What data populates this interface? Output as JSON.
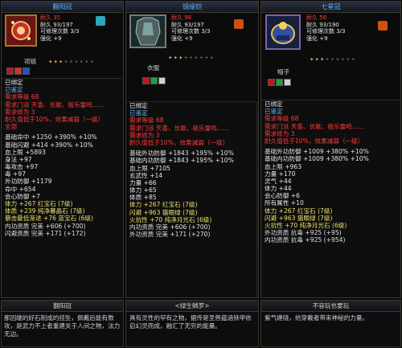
{
  "cards": [
    {
      "title": "翻阳冠",
      "info": [
        "耐久 35",
        "耐久 93/197",
        "可修理次数 3/3",
        "强化 +9"
      ],
      "type_label": "项链",
      "stars_on": 3,
      "stars_total": 9,
      "icon_name": "crown-icon",
      "lines": [
        {
          "c": "w",
          "t": "已绑定"
        },
        {
          "c": "b",
          "t": "已鉴定"
        },
        {
          "c": "r",
          "t": "需求等级 68"
        },
        {
          "c": "r",
          "t": "需求门派 天香、长歌、极乐雷鸣……"
        },
        {
          "c": "r",
          "t": "需求修为 3"
        },
        {
          "c": "r",
          "t": "耐久值低于10%，效果减弱（一级）"
        },
        {
          "c": "r",
          "t": "全部"
        },
        {
          "c": "_"
        },
        {
          "c": "w",
          "t": "基础命中 +1250 +390% +10%"
        },
        {
          "c": "w",
          "t": "基础闪避 +414 +390% +10%"
        },
        {
          "c": "w",
          "t": "血上限 +5893"
        },
        {
          "c": "w",
          "t": "身法 +97"
        },
        {
          "c": "w",
          "t": "毒攻击 +97"
        },
        {
          "c": "w",
          "t": "毒 +97"
        },
        {
          "c": "w",
          "t": "外功防御 +1179"
        },
        {
          "c": "w",
          "t": "命中 +654"
        },
        {
          "c": "w",
          "t": "会心防御 +7"
        },
        {
          "c": "y",
          "t": "体力 +267  红宝石 (7级)"
        },
        {
          "c": "y",
          "t": "体质 +239  纯净暮晶石 (7级)"
        },
        {
          "c": "y",
          "t": "暴击最低渐进 +76  蓝宝石 (6级)"
        },
        {
          "c": "g",
          "t": "内功资质   完美  +606 (+700)"
        },
        {
          "c": "g",
          "t": "闪避资质   完美  +171 (+172)"
        }
      ],
      "bottom_title": "翻阳冠",
      "bottom_text": "那因雄的好石制成的挂坠，佩戴后能有数攻，是武力不上者重建关于人间之物，法力无边。"
    },
    {
      "title": "镜缘铠",
      "info": [
        "耐久 98",
        "耐久 93/197",
        "可修理次数 3/3",
        "强化 +9"
      ],
      "type_label": "衣服",
      "stars_on": 3,
      "stars_total": 9,
      "icon_name": "armor-icon",
      "lines": [
        {
          "c": "w",
          "t": "已绑定"
        },
        {
          "c": "b",
          "t": "已鉴定"
        },
        {
          "c": "r",
          "t": "需求等级 68"
        },
        {
          "c": "r",
          "t": "需求门派 天香、长歌、极乐雷鸣……"
        },
        {
          "c": "r",
          "t": "需求修为 3"
        },
        {
          "c": "r",
          "t": "耐久值低于10%，效果减弱（一级）"
        },
        {
          "c": "_"
        },
        {
          "c": "w",
          "t": "基础外功防御 +1843 +195% +10%"
        },
        {
          "c": "w",
          "t": "基础内功防御 +1843 +195% +10%"
        },
        {
          "c": "w",
          "t": "血上限 +7105"
        },
        {
          "c": "w",
          "t": "玄武性 +14"
        },
        {
          "c": "w",
          "t": "力量 +66"
        },
        {
          "c": "w",
          "t": "体力 +65"
        },
        {
          "c": "w",
          "t": "体质 +85"
        },
        {
          "c": "y",
          "t": "体力 +267  红宝石 (7级)"
        },
        {
          "c": "y",
          "t": "闪避 +963  猫眼绿 (7级)"
        },
        {
          "c": "y",
          "t": "火抗性 +70  纯净月光石 (6级)"
        },
        {
          "c": "g",
          "t": "内功资质   完美  +606 (+700)"
        },
        {
          "c": "g",
          "t": "外功资质   完美  +171 (+270)"
        }
      ],
      "bottom_title": "<绿生鳞罗>",
      "bottom_text": "具有灵性的罕有之物，据传是圣兽蕴涵铁甲依启幻灵而成，融汇了无穷的能量。"
    },
    {
      "title": "七星冠",
      "info": [
        "耐久 56",
        "耐久 93/190",
        "可修理次数 3/3",
        "强化 +9"
      ],
      "type_label": "帽子",
      "stars_on": 3,
      "stars_total": 9,
      "icon_name": "helmet-icon",
      "lines": [
        {
          "c": "w",
          "t": "已绑定"
        },
        {
          "c": "b",
          "t": "已鉴定"
        },
        {
          "c": "r",
          "t": "需求等级 68"
        },
        {
          "c": "r",
          "t": "需求门派 天香、长歌、极乐雷鸣……"
        },
        {
          "c": "r",
          "t": "需求修为 3"
        },
        {
          "c": "r",
          "t": "耐久值低于10%，效果减弱（一级）"
        },
        {
          "c": "_"
        },
        {
          "c": "w",
          "t": "基础外功防御 +1009 +380% +10%"
        },
        {
          "c": "w",
          "t": "基础内功防御 +1009 +380% +10%"
        },
        {
          "c": "w",
          "t": "血上限 +963"
        },
        {
          "c": "w",
          "t": "力量 +170"
        },
        {
          "c": "w",
          "t": "灵气 +44"
        },
        {
          "c": "w",
          "t": "体力 +44"
        },
        {
          "c": "w",
          "t": "会心防御 +6"
        },
        {
          "c": "w",
          "t": "所有属性 +10"
        },
        {
          "c": "y",
          "t": "体力 +267  红宝石 (7级)"
        },
        {
          "c": "y",
          "t": "闪避 +963  猫眼绿 (7级)"
        },
        {
          "c": "y",
          "t": "火抗性 +70  纯净月光石 (6级)"
        },
        {
          "c": "g",
          "t": "外功资质   抗毒  +925 (+95)"
        },
        {
          "c": "g",
          "t": "内功资质   抗毒  +925 (+954)"
        }
      ],
      "bottom_title": "不容玩也要玩",
      "bottom_text": "紫气缠绕，给穿戴者带来神秘的力量。"
    }
  ]
}
